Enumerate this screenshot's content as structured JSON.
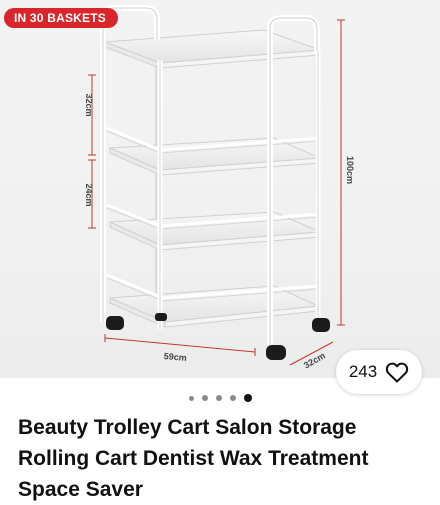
{
  "badge": {
    "label": "IN 30 BASKETS"
  },
  "product_image": {
    "dimensions": {
      "shelf_spacing_top": "32cm",
      "shelf_spacing_middle": "24cm",
      "height": "100cm",
      "width": "59cm",
      "depth": "32cm"
    }
  },
  "likes": {
    "count": "243"
  },
  "carousel": {
    "total": 5,
    "active_index": 4
  },
  "listing": {
    "title": "Beauty Trolley Cart Salon Storage Rolling Cart Dentist Wax Treatment Space Saver"
  },
  "colors": {
    "badge": "#d8262a",
    "dimension_line": "#c0392b"
  }
}
